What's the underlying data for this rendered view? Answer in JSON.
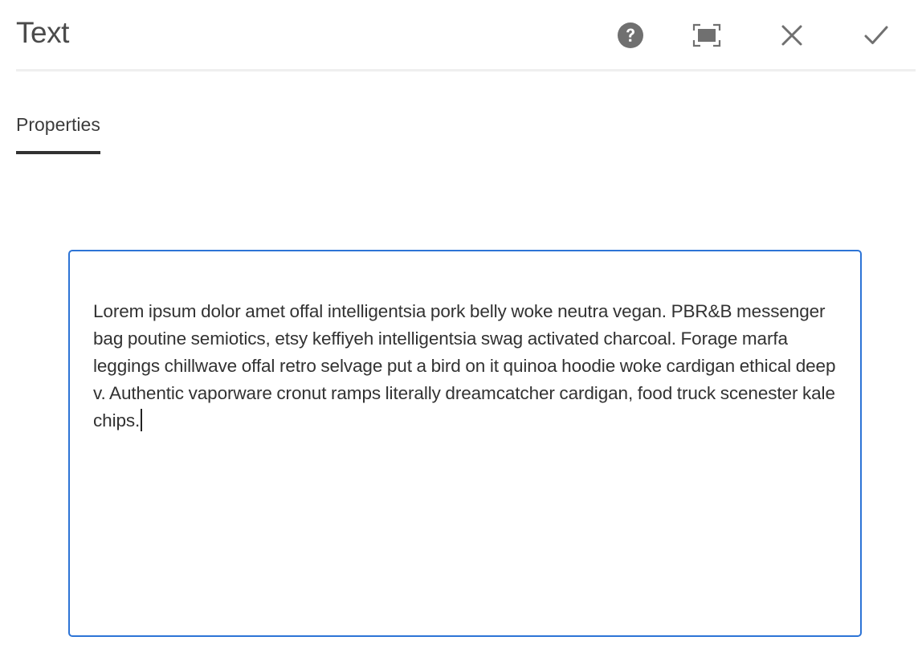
{
  "dialog": {
    "title": "Text",
    "actions": {
      "help": {
        "icon": "help-icon"
      },
      "fullscreen": {
        "icon": "fullscreen-icon"
      },
      "cancel": {
        "icon": "close-icon"
      },
      "confirm": {
        "icon": "checkmark-icon"
      }
    }
  },
  "tabs": [
    {
      "label": "Properties",
      "active": true
    }
  ],
  "editor": {
    "value": "Lorem ipsum dolor amet offal intelligentsia pork belly woke neutra vegan. PBR&B messenger bag poutine semiotics, etsy keffiyeh intelligentsia swag activated charcoal. Forage marfa leggings chillwave offal retro selvage put a bird on it quinoa hoodie woke cardigan ethical deep v. Authentic vaporware cronut ramps literally dreamcatcher cardigan, food truck scenester kale chips."
  },
  "colors": {
    "focus_border": "#2d74d6",
    "icon": "#707070",
    "tab_underline": "#323232"
  }
}
